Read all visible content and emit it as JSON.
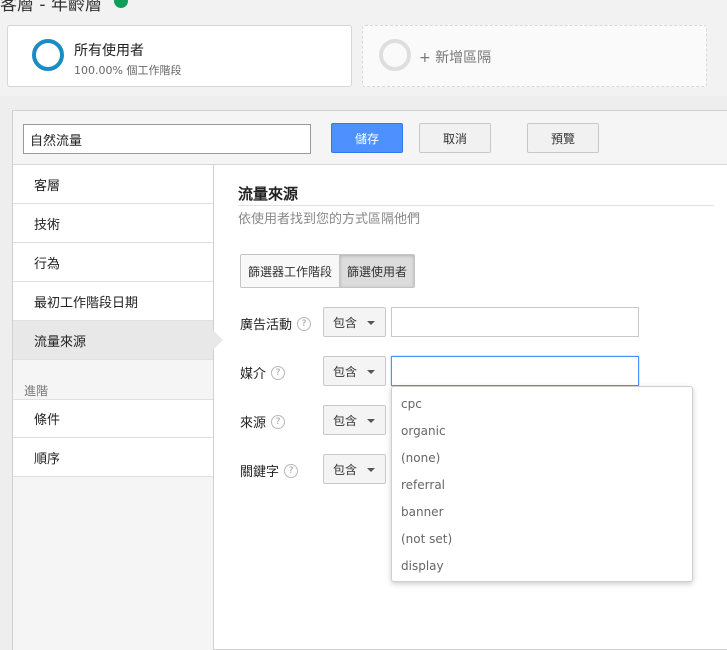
{
  "header": {
    "title": "客層 - 年齡層"
  },
  "segments": {
    "current": {
      "name": "所有使用者",
      "subtitle": "100.00% 個工作階段"
    },
    "add_label": "+ 新增區隔"
  },
  "editor": {
    "segment_name": "自然流量",
    "save_label": "儲存",
    "cancel_label": "取消",
    "preview_label": "預覽"
  },
  "sidebar": {
    "items": [
      {
        "label": "客層"
      },
      {
        "label": "技術"
      },
      {
        "label": "行為"
      },
      {
        "label": "最初工作階段日期"
      },
      {
        "label": "流量來源",
        "active": true
      }
    ],
    "advanced_section": "進階",
    "advanced_items": [
      {
        "label": "條件"
      },
      {
        "label": "順序"
      }
    ]
  },
  "panel": {
    "title": "流量來源",
    "subtitle": "依使用者找到您的方式區隔他們",
    "toggle": {
      "sessions": "篩選器工作階段",
      "users": "篩選使用者",
      "selected": "users"
    },
    "help_glyph": "?",
    "rows": [
      {
        "label": "廣告活動",
        "operator": "包含",
        "value": ""
      },
      {
        "label": "媒介",
        "operator": "包含",
        "value": "",
        "focused": true
      },
      {
        "label": "來源",
        "operator": "包含",
        "value": ""
      },
      {
        "label": "關鍵字",
        "operator": "包含",
        "value": ""
      }
    ],
    "medium_suggestions": [
      "cpc",
      "organic",
      "(none)",
      "referral",
      "banner",
      "(not set)",
      "display"
    ]
  },
  "colors": {
    "accent": "#4d90fe",
    "segment_ring": "#1a8bc4",
    "check": "#0f9d58"
  }
}
